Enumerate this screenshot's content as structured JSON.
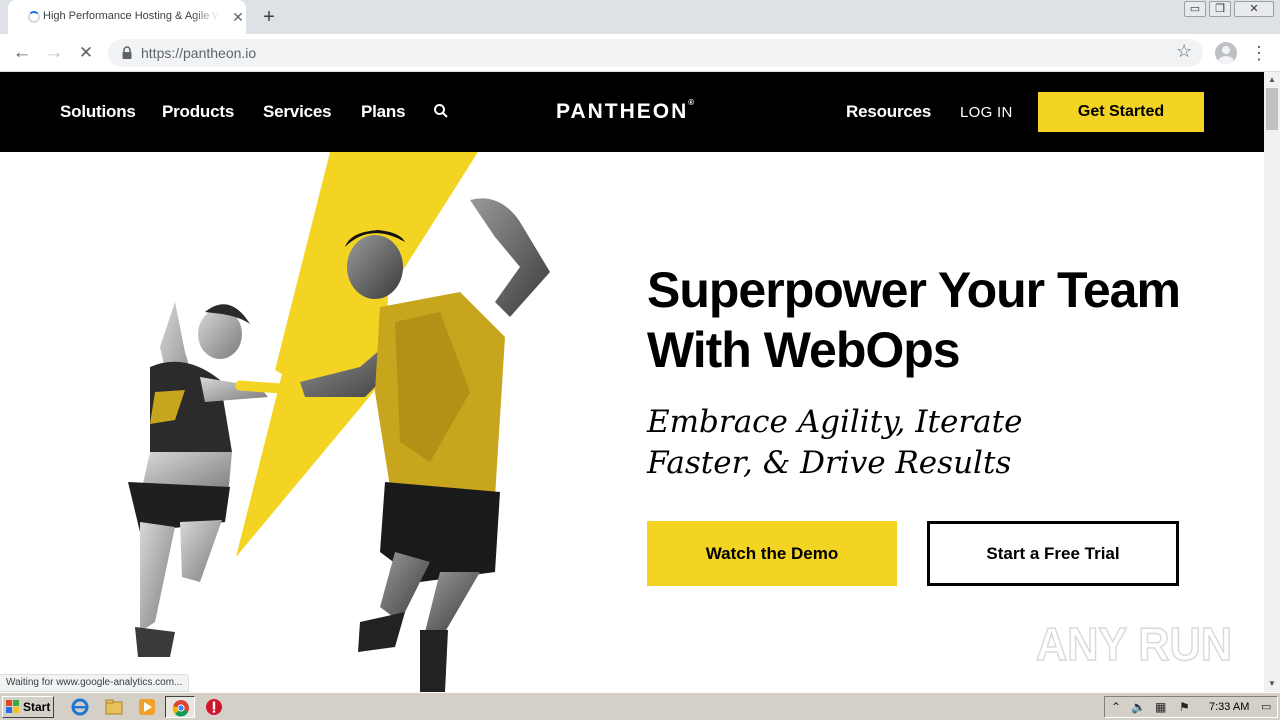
{
  "browser": {
    "tab_title": "High Performance Hosting & Agile WebOps",
    "tab_close": "✕",
    "new_tab": "+",
    "url": "https://pantheon.io",
    "window_controls": {
      "minimize": "▭",
      "restore": "❐",
      "close": "✕"
    },
    "back": "←",
    "forward": "→",
    "stop": "✕",
    "star": "☆",
    "menu": "⋮",
    "status_text": "Waiting for www.google-analytics.com..."
  },
  "site": {
    "nav_left": [
      "Solutions",
      "Products",
      "Services",
      "Plans"
    ],
    "logo": "PANTHEON",
    "logo_mark": "®",
    "resources": "Resources",
    "login": "LOG IN",
    "get_started": "Get Started"
  },
  "hero": {
    "title_line1": "Superpower Your Team",
    "title_line2": "With WebOps",
    "sub_line1": "Embrace Agility, Iterate",
    "sub_line2": "Faster, & Drive Results",
    "btn_demo": "Watch the Demo",
    "btn_trial": "Start a Free Trial"
  },
  "watermark": {
    "text": "ANY RUN"
  },
  "taskbar": {
    "start": "Start",
    "clock": "7:33 AM",
    "tray_icons": [
      "chevron-up-icon",
      "speaker-icon",
      "network-icon",
      "flag-icon"
    ]
  },
  "colors": {
    "brand_yellow": "#f3d422",
    "header_black": "#000000",
    "chrome_tabstrip": "#dee1e6",
    "taskbar_gray": "#d4d0c8"
  }
}
